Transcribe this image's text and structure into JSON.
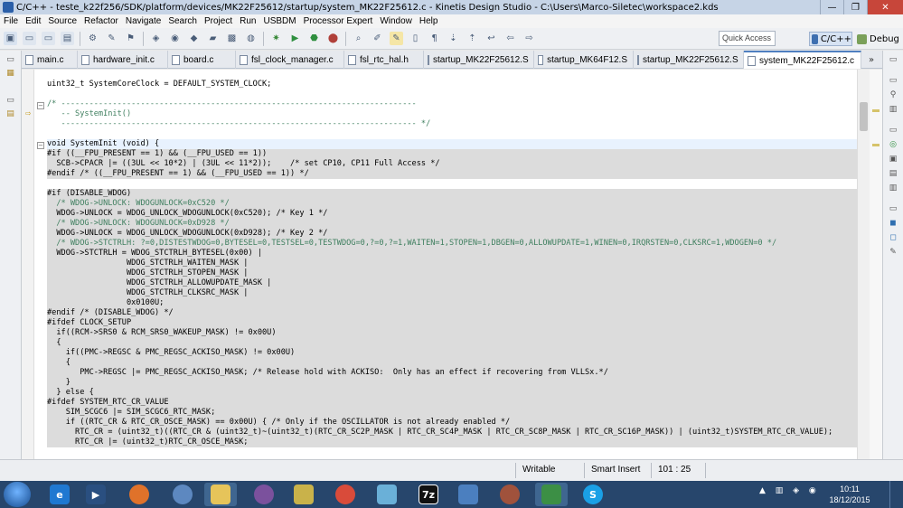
{
  "window": {
    "title": "C/C++ - teste_k22f256/SDK/platform/devices/MK22F25612/startup/system_MK22F25612.c - Kinetis Design Studio - C:\\Users\\Marco-Siletec\\workspace2.kds",
    "minimize_glyph": "—",
    "maximize_glyph": "❐",
    "close_glyph": "✕"
  },
  "menu": [
    "File",
    "Edit",
    "Source",
    "Refactor",
    "Navigate",
    "Search",
    "Project",
    "Run",
    "USBDM",
    "Processor Expert",
    "Window",
    "Help"
  ],
  "toolbar": {
    "quick_access": "Quick Access",
    "perspective_cpp": "C/C++",
    "perspective_debug": "Debug"
  },
  "tabs": [
    {
      "label": "main.c"
    },
    {
      "label": "hardware_init.c"
    },
    {
      "label": "board.c"
    },
    {
      "label": "fsl_clock_manager.c"
    },
    {
      "label": "fsl_rtc_hal.h"
    },
    {
      "label": "startup_MK22F25612.S"
    },
    {
      "label": "startup_MK64F12.S"
    },
    {
      "label": "startup_MK22F25612.S"
    },
    {
      "label": "system_MK22F25612.c",
      "active": true
    }
  ],
  "tabs_overflow": "»",
  "code": {
    "lines": [
      "",
      "uint32_t SystemCoreClock = DEFAULT_SYSTEM_CLOCK;",
      "",
      "/* ----------------------------------------------------------------------------",
      "   -- SystemInit()",
      "   ---------------------------------------------------------------------------- */",
      "",
      "void SystemInit (void) {",
      "#if ((__FPU_PRESENT == 1) && (__FPU_USED == 1))",
      "  SCB->CPACR |= ((3UL << 10*2) | (3UL << 11*2));    /* set CP10, CP11 Full Access */",
      "#endif /* ((__FPU_PRESENT == 1) && (__FPU_USED == 1)) */",
      "",
      "#if (DISABLE_WDOG)",
      "  /* WDOG->UNLOCK: WDOGUNLOCK=0xC520 */",
      "  WDOG->UNLOCK = WDOG_UNLOCK_WDOGUNLOCK(0xC520); /* Key 1 */",
      "  /* WDOG->UNLOCK: WDOGUNLOCK=0xD928 */",
      "  WDOG->UNLOCK = WDOG_UNLOCK_WDOGUNLOCK(0xD928); /* Key 2 */",
      "  /* WDOG->STCTRLH: ?=0,DISTESTWDOG=0,BYTESEL=0,TESTSEL=0,TESTWDOG=0,?=0,?=1,WAITEN=1,STOPEN=1,DBGEN=0,ALLOWUPDATE=1,WINEN=0,IRQRSTEN=0,CLKSRC=1,WDOGEN=0 */",
      "  WDOG->STCTRLH = WDOG_STCTRLH_BYTESEL(0x00) |",
      "                 WDOG_STCTRLH_WAITEN_MASK |",
      "                 WDOG_STCTRLH_STOPEN_MASK |",
      "                 WDOG_STCTRLH_ALLOWUPDATE_MASK |",
      "                 WDOG_STCTRLH_CLKSRC_MASK |",
      "                 0x0100U;",
      "#endif /* (DISABLE_WDOG) */",
      "#ifdef CLOCK_SETUP",
      "  if((RCM->SRS0 & RCM_SRS0_WAKEUP_MASK) != 0x00U)",
      "  {",
      "    if((PMC->REGSC & PMC_REGSC_ACKISO_MASK) != 0x00U)",
      "    {",
      "       PMC->REGSC |= PMC_REGSC_ACKISO_MASK; /* Release hold with ACKISO:  Only has an effect if recovering from VLLSx.*/",
      "    }",
      "  } else {",
      "#ifdef SYSTEM_RTC_CR_VALUE",
      "    SIM_SCGC6 |= SIM_SCGC6_RTC_MASK;",
      "    if ((RTC_CR & RTC_CR_OSCE_MASK) == 0x00U) { /* Only if the OSCILLATOR is not already enabled */",
      "      RTC_CR = (uint32_t)((RTC_CR & (uint32_t)~(uint32_t)(RTC_CR_SC2P_MASK | RTC_CR_SC4P_MASK | RTC_CR_SC8P_MASK | RTC_CR_SC16P_MASK)) | (uint32_t)SYSTEM_RTC_CR_VALUE);",
      "      RTC_CR |= (uint32_t)RTC_CR_OSCE_MASK;"
    ]
  },
  "status": {
    "writable": "Writable",
    "insert_mode": "Smart Insert",
    "position": "101 : 25"
  },
  "taskbar": {
    "time": "10:11",
    "date": "18/12/2015",
    "app_7z": "7z"
  }
}
